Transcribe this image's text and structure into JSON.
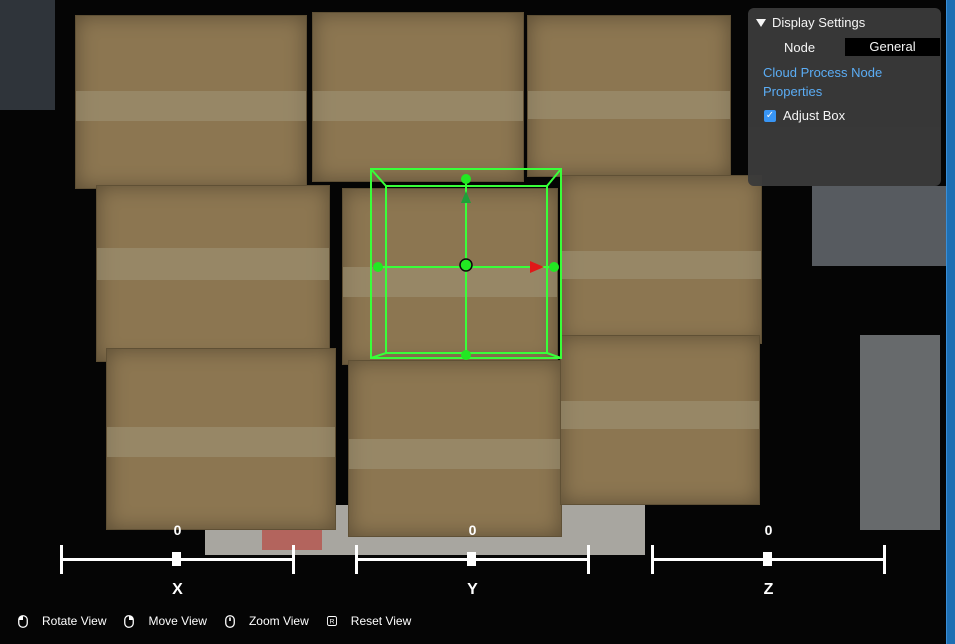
{
  "settings": {
    "title": "Display Settings",
    "node_label": "Node",
    "node_value": "General",
    "cloud_link": "Cloud Process Node Properties",
    "adjust_box_label": "Adjust Box",
    "adjust_box_checked": true
  },
  "axes": [
    {
      "label": "X",
      "value": "0",
      "level": 0.5
    },
    {
      "label": "Y",
      "value": "0",
      "level": 0.5
    },
    {
      "label": "Z",
      "value": "0",
      "level": 0.5
    }
  ],
  "hints": {
    "rotate": "Rotate View",
    "move": "Move View",
    "zoom": "Zoom View",
    "reset": "Reset View",
    "reset_key": "R"
  },
  "colors": {
    "accent": "#5fb4ff",
    "checkbox": "#3b9bff",
    "bounding_box": "#39ff39",
    "axis_x_arrow": "#e01818",
    "frame": "#1e6fb3"
  },
  "icons": {
    "settings_toggle": "triangle-down-icon",
    "rotate": "mouse-left-icon",
    "move": "mouse-right-icon",
    "zoom": "mouse-wheel-icon",
    "reset": "key-r-icon"
  }
}
